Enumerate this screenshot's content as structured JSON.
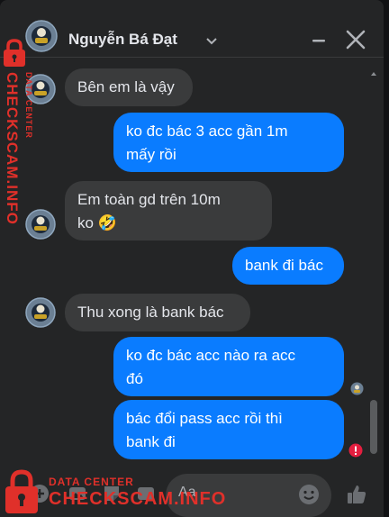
{
  "header": {
    "contact_name": "Nguyễn Bá Đạt ",
    "icons": [
      "avatar",
      "chevron-down-icon",
      "minimize-icon",
      "close-icon"
    ]
  },
  "messages": [
    {
      "direction": "incoming",
      "text": "Bên em là vậy"
    },
    {
      "direction": "outgoing",
      "text": "ko đc bác 3 acc gần 1m mấy rồi",
      "lines": [
        "ko đc bác 3 acc gần 1m",
        "mấy rồi"
      ]
    },
    {
      "direction": "incoming",
      "text": "Em toàn gd trên 10m ko 🤣",
      "lines": [
        "Em toàn gd trên 10m",
        "ko 🤣"
      ]
    },
    {
      "direction": "outgoing",
      "text": "bank đi bác"
    },
    {
      "direction": "incoming",
      "text": "Thu xong là bank bác"
    },
    {
      "direction": "outgoing",
      "text": "ko đc bác acc nào ra acc đó",
      "lines": [
        "ko đc bác acc nào ra acc",
        "đó"
      ]
    },
    {
      "direction": "outgoing",
      "text": "bác đổi pass acc rồi thì bank đi",
      "lines": [
        "bác đổi pass acc rồi thì",
        "bank đi"
      ],
      "status": "error"
    }
  ],
  "composer": {
    "placeholder": "Aa",
    "icons": [
      "plus-circle-icon",
      "image-icon",
      "sticker-icon",
      "gif-icon",
      "emoji-icon",
      "like-icon"
    ]
  },
  "watermark": {
    "vertical_text": "CHECKSCAM.INFO",
    "vertical_small": "DATA CENTER",
    "bottom_small": "DATA CENTER",
    "bottom_large": "CHECKSCAM.INFO"
  },
  "colors": {
    "background": "#242526",
    "incoming_bubble": "#3a3b3c",
    "outgoing_bubble": "#0a7cff",
    "watermark_red": "#e0302a",
    "error_red": "#e41e3f"
  }
}
